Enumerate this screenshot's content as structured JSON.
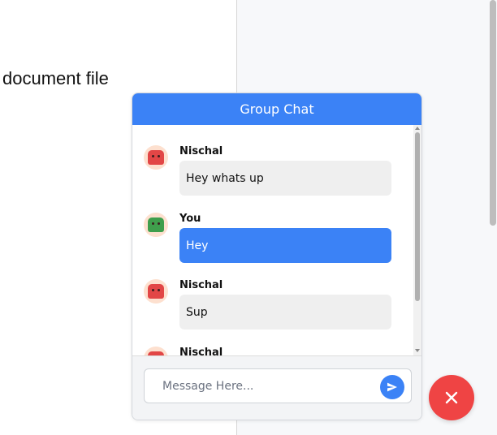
{
  "document": {
    "text": "document file"
  },
  "chat": {
    "title": "Group Chat",
    "messages": [
      {
        "sender": "Nischal",
        "text": "Hey whats up",
        "avatar": "red-monster-avatar",
        "is_self": false
      },
      {
        "sender": "You",
        "text": "Hey",
        "avatar": "green-monster-avatar",
        "is_self": true
      },
      {
        "sender": "Nischal",
        "text": "Sup",
        "avatar": "red-monster-avatar",
        "is_self": false
      },
      {
        "sender": "Nischal",
        "text": "",
        "avatar": "red-monster-avatar",
        "is_self": false
      }
    ],
    "input": {
      "placeholder": "Message Here...",
      "value": ""
    },
    "send_icon": "paper-plane-icon"
  },
  "close_icon": "close-icon",
  "colors": {
    "accent": "#3b82f6",
    "close_button": "#ef4444",
    "other_bubble": "#efefef"
  }
}
